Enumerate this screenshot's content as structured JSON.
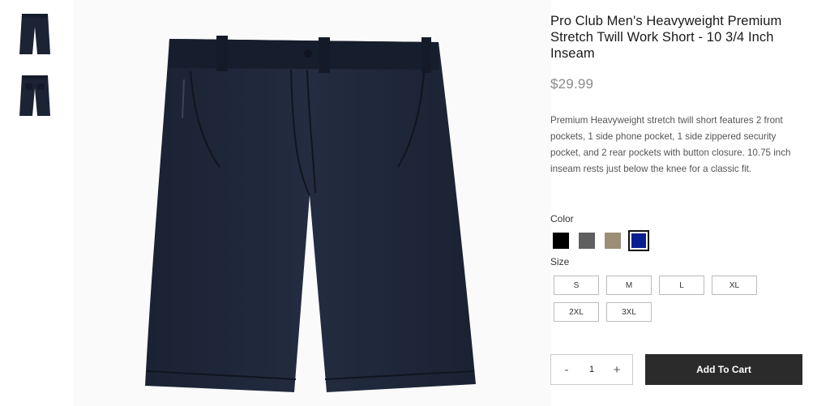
{
  "gallery": {
    "thumbnails": [
      {
        "icon": "shorts-front-icon",
        "color": "#1b2334"
      },
      {
        "icon": "shorts-back-icon",
        "color": "#1b2334"
      }
    ],
    "main_icon": "shorts-front-icon",
    "main_color": "#1f2738"
  },
  "product": {
    "title": "Pro Club Men's Heavyweight Premium Stretch Twill Work Short - 10 3/4 Inch Inseam",
    "price": "$29.99",
    "description": "Premium Heavyweight stretch twill short features 2 front pockets, 1 side phone pocket, 1 side zippered security pocket, and 2 rear pockets with button closure. 10.75 inch inseam rests just below the knee for a classic fit."
  },
  "color": {
    "label": "Color",
    "swatches": [
      {
        "name": "black",
        "hex": "#000000",
        "selected": false
      },
      {
        "name": "gray",
        "hex": "#5f5f5f",
        "selected": false
      },
      {
        "name": "khaki",
        "hex": "#9c8d77",
        "selected": false
      },
      {
        "name": "navy",
        "hex": "#0a1f8f",
        "selected": true
      }
    ]
  },
  "size": {
    "label": "Size",
    "options": [
      "S",
      "M",
      "L",
      "XL",
      "2XL",
      "3XL"
    ]
  },
  "cart": {
    "decrement": "-",
    "quantity": "1",
    "increment": "+",
    "add_label": "Add To Cart"
  }
}
